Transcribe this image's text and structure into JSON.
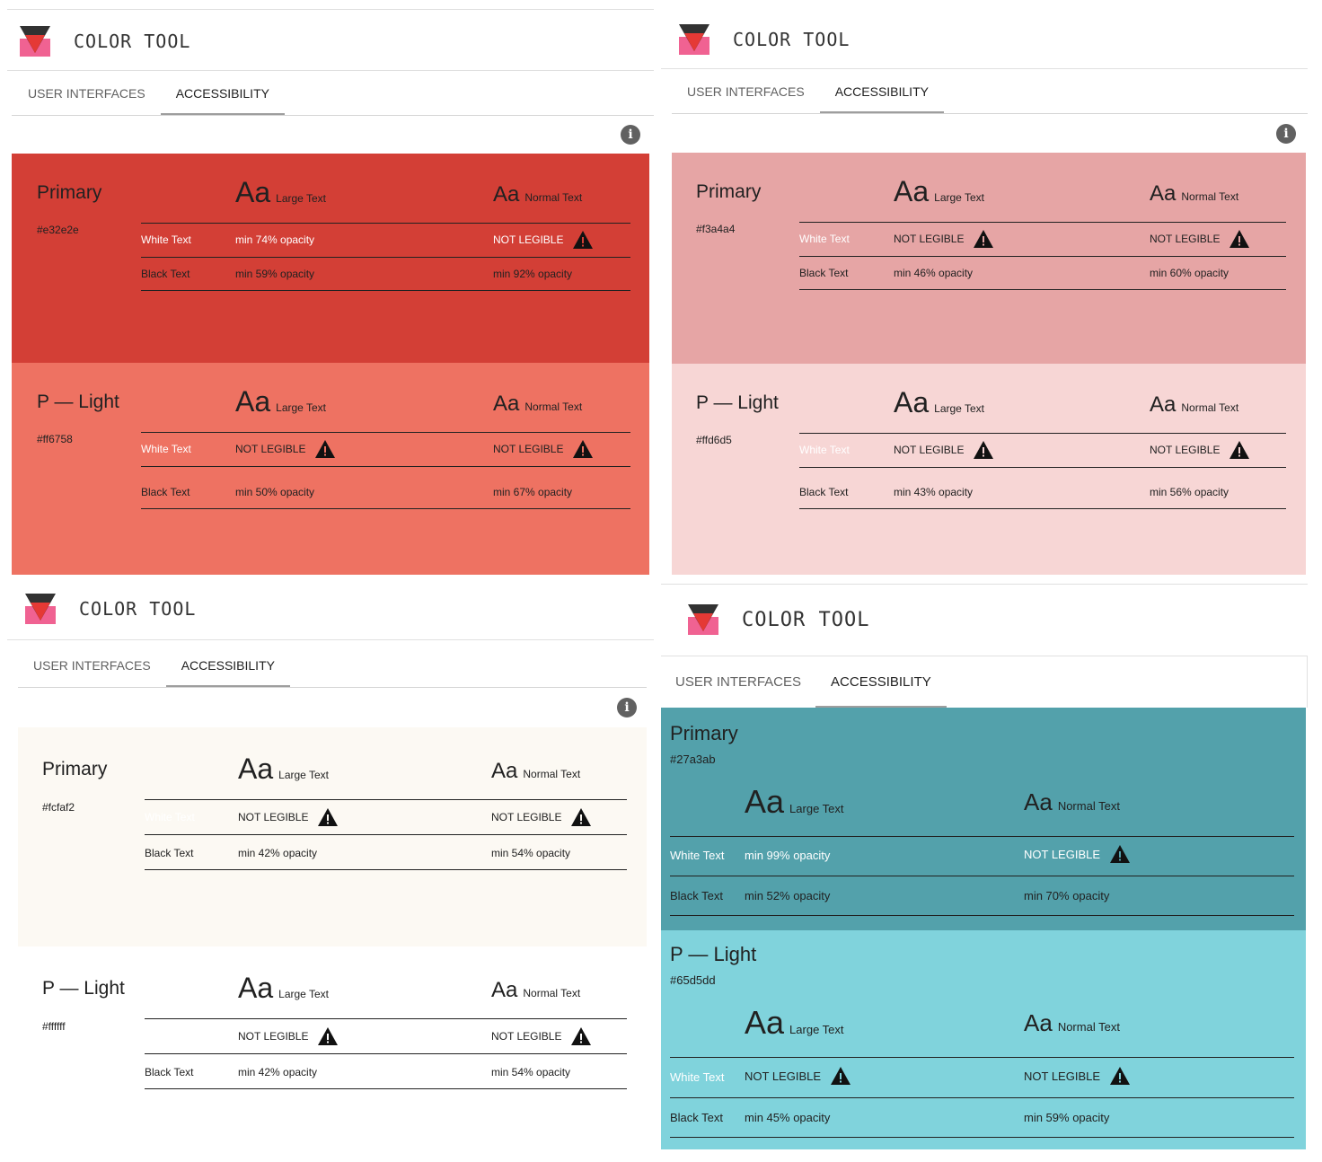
{
  "app": {
    "title": "COLOR TOOL"
  },
  "tabs": {
    "user_interfaces": "USER INTERFACES",
    "accessibility": "ACCESSIBILITY"
  },
  "labels": {
    "large_text": "Large Text",
    "normal_text": "Normal Text",
    "aa": "Aa",
    "white_text": "White Text",
    "black_text": "Black Text",
    "not_legible": "NOT LEGIBLE"
  },
  "colors": {
    "red_primary_bg": "#d33f36",
    "red_light_bg": "#ee7262",
    "pink_primary_bg": "#e6a5a5",
    "pink_light_bg": "#f7d6d5",
    "cream_primary_bg": "#fcf9f3",
    "white_light_bg": "#ffffff",
    "teal_primary_bg": "#53a1ab",
    "teal_light_bg": "#80d3dc"
  },
  "panels": [
    {
      "primary": {
        "name": "Primary",
        "hex": "#e32e2e",
        "white_large": "min 74% opacity",
        "white_normal": "NOT LEGIBLE",
        "black_large": "min 59% opacity",
        "black_normal": "min 92% opacity"
      },
      "light": {
        "name": "P — Light",
        "hex": "#ff6758",
        "white_large": "NOT LEGIBLE",
        "white_normal": "NOT LEGIBLE",
        "black_large": "min 50% opacity",
        "black_normal": "min 67% opacity"
      }
    },
    {
      "primary": {
        "name": "Primary",
        "hex": "#f3a4a4",
        "white_large": "NOT LEGIBLE",
        "white_normal": "NOT LEGIBLE",
        "black_large": "min 46% opacity",
        "black_normal": "min 60% opacity"
      },
      "light": {
        "name": "P — Light",
        "hex": "#ffd6d5",
        "white_large": "NOT LEGIBLE",
        "white_normal": "NOT LEGIBLE",
        "black_large": "min 43% opacity",
        "black_normal": "min 56% opacity"
      }
    },
    {
      "primary": {
        "name": "Primary",
        "hex": "#fcfaf2",
        "white_large": "NOT LEGIBLE",
        "white_normal": "NOT LEGIBLE",
        "black_large": "min 42% opacity",
        "black_normal": "min 54% opacity"
      },
      "light": {
        "name": "P — Light",
        "hex": "#ffffff",
        "white_large": "NOT LEGIBLE",
        "white_normal": "NOT LEGIBLE",
        "black_large": "min 42% opacity",
        "black_normal": "min 54% opacity"
      }
    },
    {
      "primary": {
        "name": "Primary",
        "hex": "#27a3ab",
        "white_large": "min 99% opacity",
        "white_normal": "NOT LEGIBLE",
        "black_large": "min 52% opacity",
        "black_normal": "min 70% opacity"
      },
      "light": {
        "name": "P — Light",
        "hex": "#65d5dd",
        "white_large": "NOT LEGIBLE",
        "white_normal": "NOT LEGIBLE",
        "black_large": "min 45% opacity",
        "black_normal": "min 59% opacity"
      }
    }
  ]
}
